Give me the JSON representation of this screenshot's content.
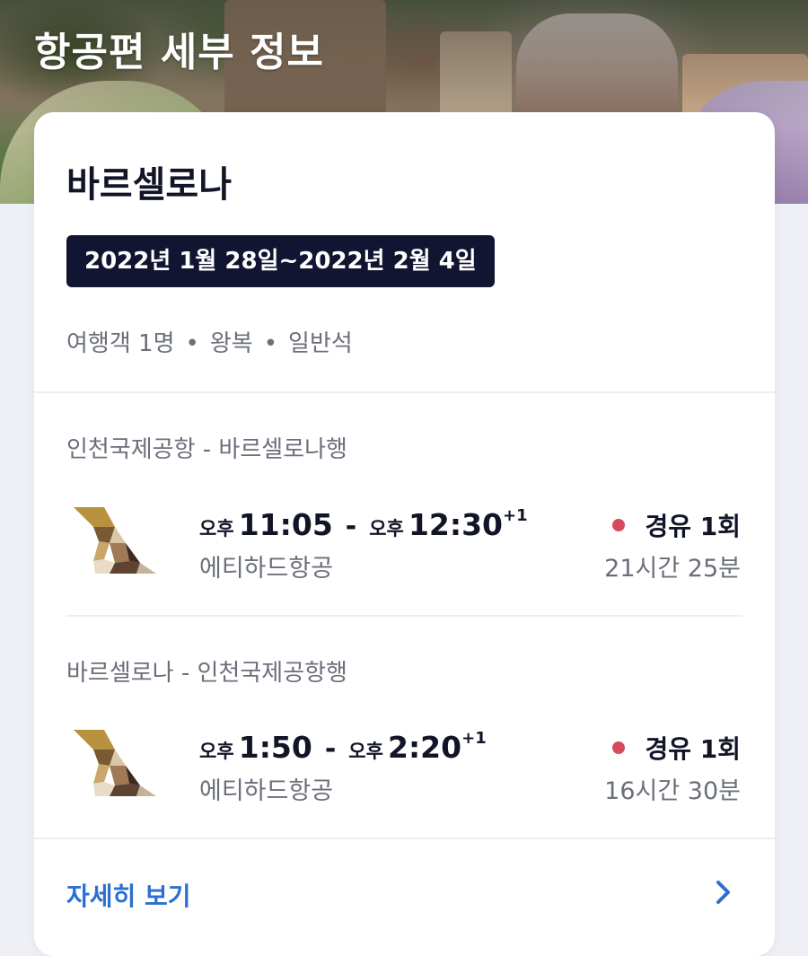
{
  "header": {
    "title": "항공편 세부 정보",
    "background_image": "park-guell-barcelona-photo"
  },
  "trip": {
    "destination": "바르셀로나",
    "dates": "2022년 1월 28일~2022년 2월 4일",
    "meta": {
      "passengers": "여행객 1명",
      "trip_type": "왕복",
      "cabin": "일반석",
      "separator": "•"
    }
  },
  "flights": [
    {
      "route": "인천국제공항 - 바르셀로나행",
      "depart_ampm": "오후",
      "depart_time": "11:05",
      "dash": "-",
      "arrive_ampm": "오후",
      "arrive_time": "12:30",
      "day_offset": "+1",
      "airline": "에티하드항공",
      "stops": "경유 1회",
      "duration": "21시간 25분"
    },
    {
      "route": "바르셀로나 - 인천국제공항행",
      "depart_ampm": "오후",
      "depart_time": "1:50",
      "dash": "-",
      "arrive_ampm": "오후",
      "arrive_time": "2:20",
      "day_offset": "+1",
      "airline": "에티하드항공",
      "stops": "경유 1회",
      "duration": "16시간 30분"
    }
  ],
  "footer": {
    "details_label": "자세히 보기",
    "chevron_icon": "chevron-right-icon"
  },
  "colors": {
    "title_dark": "#111527",
    "badge_bg": "#111531",
    "link_blue": "#2d6fd0",
    "stop_dot": "#d64a5c",
    "muted_text": "#6b6f7b"
  }
}
